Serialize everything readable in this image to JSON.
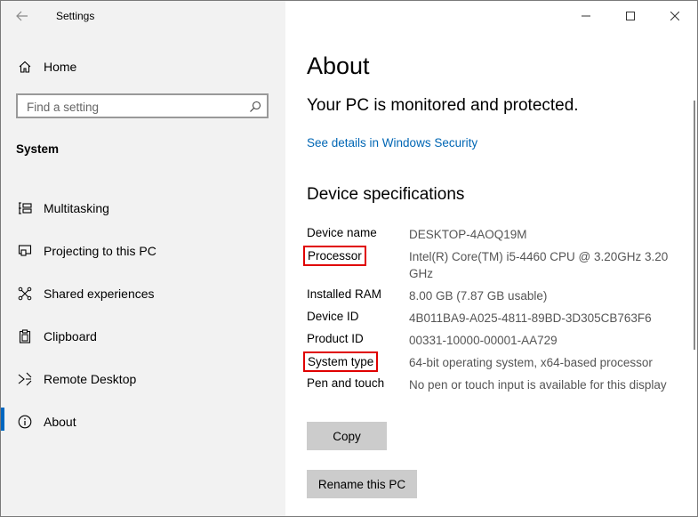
{
  "window": {
    "title": "Settings"
  },
  "nav": {
    "home_label": "Home",
    "search_placeholder": "Find a setting",
    "section_title": "System",
    "items": [
      {
        "label": "Multitasking",
        "icon": "multitasking-icon"
      },
      {
        "label": "Projecting to this PC",
        "icon": "projecting-icon"
      },
      {
        "label": "Shared experiences",
        "icon": "shared-experiences-icon"
      },
      {
        "label": "Clipboard",
        "icon": "clipboard-icon"
      },
      {
        "label": "Remote Desktop",
        "icon": "remote-desktop-icon"
      },
      {
        "label": "About",
        "icon": "info-icon",
        "selected": true
      }
    ]
  },
  "main": {
    "title": "About",
    "protection_status": "Your PC is monitored and protected.",
    "security_link": "See details in Windows Security",
    "specs_heading": "Device specifications",
    "specs": [
      {
        "label": "Device name",
        "value": "DESKTOP-4AOQ19M",
        "highlighted": false
      },
      {
        "label": "Processor",
        "value": "Intel(R) Core(TM) i5-4460  CPU @ 3.20GHz   3.20 GHz",
        "highlighted": true
      },
      {
        "label": "Installed RAM",
        "value": "8.00 GB (7.87 GB usable)",
        "highlighted": false
      },
      {
        "label": "Device ID",
        "value": "4B011BA9-A025-4811-89BD-3D305CB763F6",
        "highlighted": false
      },
      {
        "label": "Product ID",
        "value": "00331-10000-00001-AA729",
        "highlighted": false
      },
      {
        "label": "System type",
        "value": "64-bit operating system, x64-based processor",
        "highlighted": true
      },
      {
        "label": "Pen and touch",
        "value": "No pen or touch input is available for this display",
        "highlighted": false
      }
    ],
    "copy_button": "Copy",
    "rename_button": "Rename this PC"
  },
  "colors": {
    "accent": "#0067c0",
    "link": "#0066b4",
    "highlight_box": "#e00000",
    "button_bg": "#cccccc",
    "nav_bg": "#f2f2f2"
  }
}
